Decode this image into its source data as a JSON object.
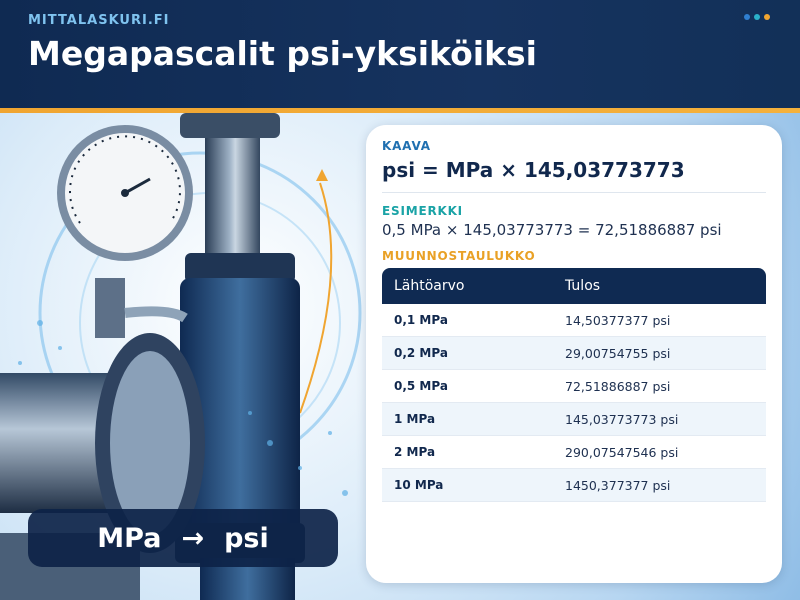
{
  "header": {
    "site_name": "MITTALASKURI.FI",
    "title": "Megapascalit psi-yksiköiksi",
    "dot_colors": [
      "#2f7fd0",
      "#2bb0c9",
      "#f0a531"
    ]
  },
  "hero": {
    "from_unit": "MPa",
    "arrow": "→",
    "to_unit": "psi"
  },
  "card": {
    "formula_label": "KAAVA",
    "formula": "psi = MPa × 145,03773773",
    "example_label": "ESIMERKKI",
    "example": "0,5 MPa × 145,03773773 = 72,51886887 psi",
    "table_label": "MUUNNOSTAULUKKO",
    "table": {
      "headers": [
        "Lähtöarvo",
        "Tulos"
      ],
      "rows": [
        [
          "0,1 MPa",
          "14,50377377 psi"
        ],
        [
          "0,2 MPa",
          "29,00754755 psi"
        ],
        [
          "0,5 MPa",
          "72,51886887 psi"
        ],
        [
          "1 MPa",
          "145,03773773 psi"
        ],
        [
          "2 MPa",
          "290,07547546 psi"
        ],
        [
          "10 MPa",
          "1450,377377 psi"
        ]
      ]
    }
  },
  "colors": {
    "formula_label": "#1f6fb0",
    "example_label": "#1aa3a6",
    "table_label": "#e9a126",
    "accent": "#f0a531",
    "navy": "#0f2a52"
  }
}
